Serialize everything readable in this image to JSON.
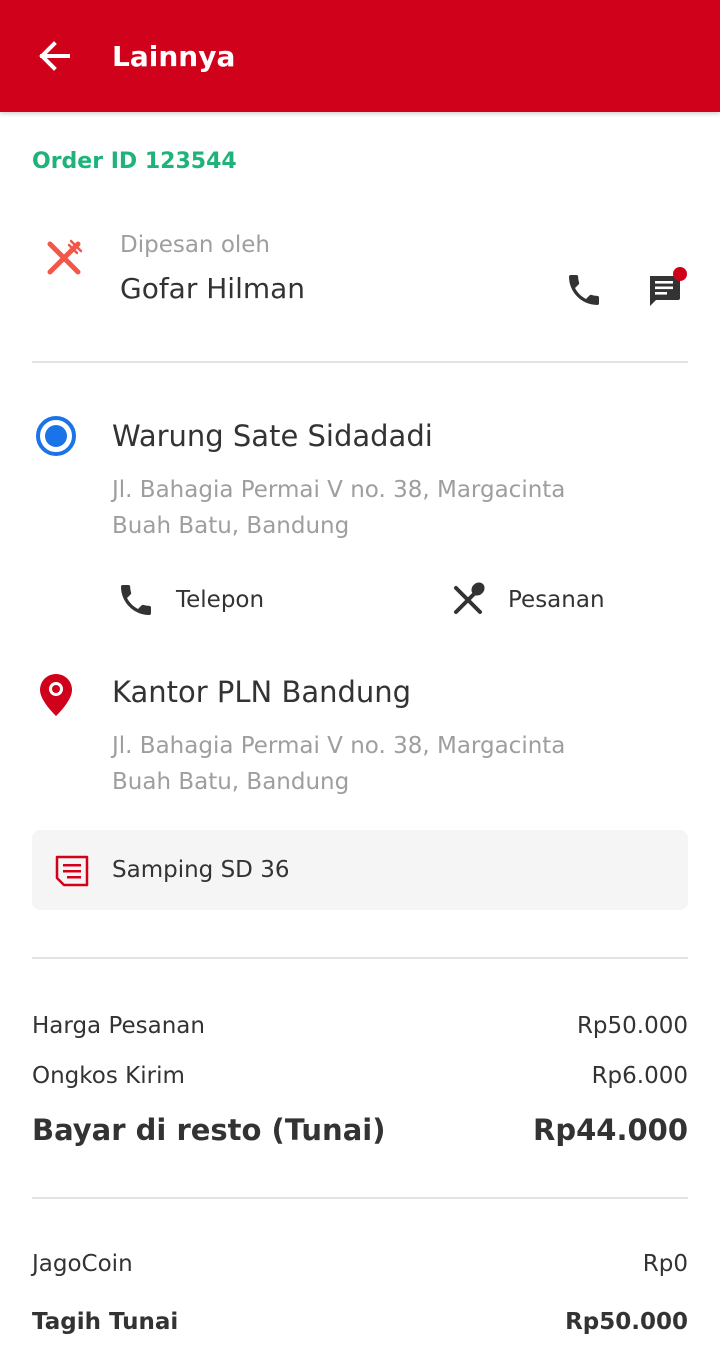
{
  "header": {
    "title": "Lainnya",
    "back_icon": "arrow-left-icon"
  },
  "order": {
    "id_label": "Order ID 123544"
  },
  "orderer": {
    "label": "Dipesan oleh",
    "name": "Gofar Hilman",
    "icon": "fork-knife-icon",
    "actions": [
      {
        "icon": "phone-icon"
      },
      {
        "icon": "chat-icon",
        "has_notification": true
      }
    ]
  },
  "pickup": {
    "name": "Warung Sate Sidadadi",
    "address_line1": "Jl. Bahagia Permai V no. 38, Margacinta",
    "address_line2": "Buah Batu, Bandung",
    "actions": [
      {
        "label": "Telepon",
        "icon": "phone-icon"
      },
      {
        "label": "Pesanan",
        "icon": "utensils-icon"
      }
    ]
  },
  "destination": {
    "name": "Kantor PLN Bandung",
    "address_line1": "Jl. Bahagia Permai V no. 38, Margacinta",
    "address_line2": "Buah Batu, Bandung",
    "note": "Samping SD 36"
  },
  "payment": {
    "order_price_label": "Harga Pesanan",
    "order_price_value": "Rp50.000",
    "delivery_fee_label": "Ongkos Kirim",
    "delivery_fee_value": "Rp6.000",
    "pay_label": "Bayar di resto (Tunai)",
    "pay_value": "Rp44.000"
  },
  "billing": {
    "coin_label": "JagoCoin",
    "coin_value": "Rp0",
    "cash_label": "Tagih Tunai",
    "cash_value": "Rp50.000"
  },
  "colors": {
    "brand_red": "#D0021B",
    "order_id_green": "#1FB37A",
    "pickup_blue": "#1A73E8",
    "muted_text": "#9E9E9E",
    "icon_dark": "#333333",
    "fork_icon": "#F2574A"
  }
}
